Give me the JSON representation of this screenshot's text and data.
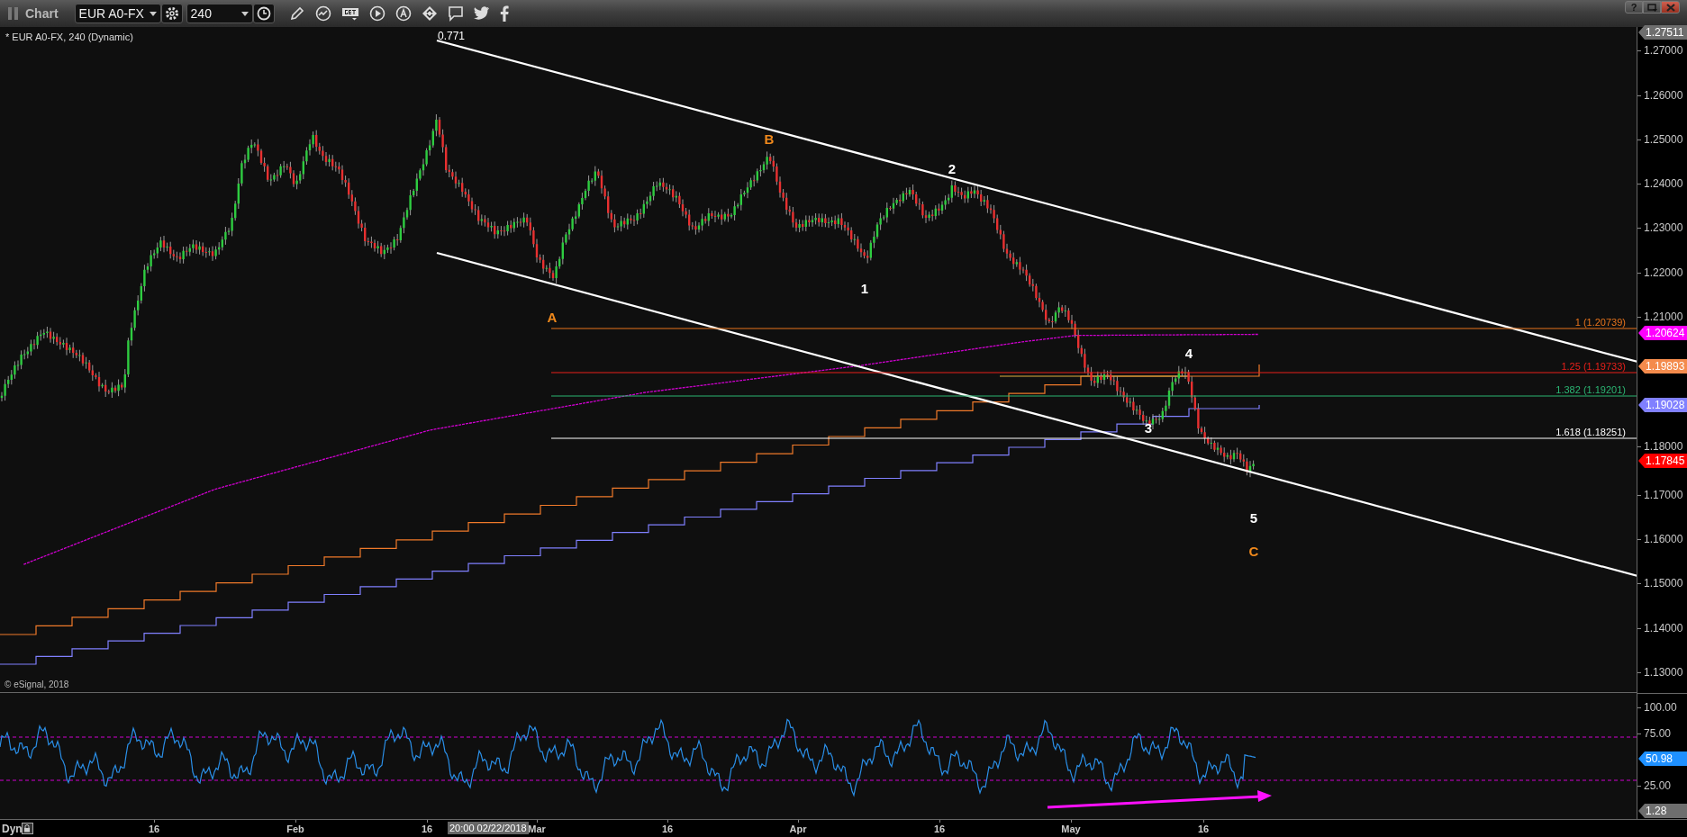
{
  "window": {
    "title": "Chart",
    "help": "?"
  },
  "toolbar": {
    "symbol": "EUR A0-FX",
    "interval": "240"
  },
  "chart": {
    "caption": "* EUR A0-FX, 240 (Dynamic)",
    "trendline_label": "0.771",
    "copyright": "© eSignal, 2018",
    "wave_labels": [
      {
        "text": "B",
        "color": "#f0891c"
      },
      {
        "text": "2",
        "color": "#ffffff"
      },
      {
        "text": "1",
        "color": "#ffffff"
      },
      {
        "text": "A",
        "color": "#f0891c"
      },
      {
        "text": "4",
        "color": "#ffffff"
      },
      {
        "text": "3",
        "color": "#ffffff"
      },
      {
        "text": "5",
        "color": "#ffffff"
      },
      {
        "text": "C",
        "color": "#f0891c"
      }
    ],
    "fib_levels": [
      {
        "label": "1 (1.20739)",
        "color": "#e8741c"
      },
      {
        "label": "1.25 (1.19733)",
        "color": "#e8201a"
      },
      {
        "label": "1.382 (1.19201)",
        "color": "#2bb673"
      },
      {
        "label": "1.618 (1.18251)",
        "color": "#ffffff"
      }
    ],
    "price_ticks": [
      "1.27000",
      "1.26000",
      "1.25000",
      "1.24000",
      "1.23000",
      "1.22000",
      "1.21000",
      "1.18000",
      "1.17000",
      "1.16000",
      "1.15000",
      "1.14000",
      "1.13000"
    ],
    "price_tags": [
      {
        "value": "1.27511",
        "color": "#6e6e6e"
      },
      {
        "value": "1.20624",
        "color": "#ff00ff"
      },
      {
        "value": "1.19893",
        "color": "#f48b4c"
      },
      {
        "value": "1.19028",
        "color": "#8080ff"
      },
      {
        "value": "1.17845",
        "color": "#ff0000"
      }
    ]
  },
  "oscillator": {
    "ticks": [
      "100.00",
      "75.00",
      "25.00"
    ],
    "tags": [
      {
        "value": "50.98",
        "color": "#1e90ff"
      },
      {
        "value": "1.28",
        "color": "#6e6e6e"
      }
    ]
  },
  "time_axis": {
    "mode": "Dyn",
    "cursor": "20:00 02/22/2018",
    "labels": [
      "16",
      "Feb",
      "16",
      "Mar",
      "16",
      "Apr",
      "16",
      "May",
      "16"
    ]
  }
}
